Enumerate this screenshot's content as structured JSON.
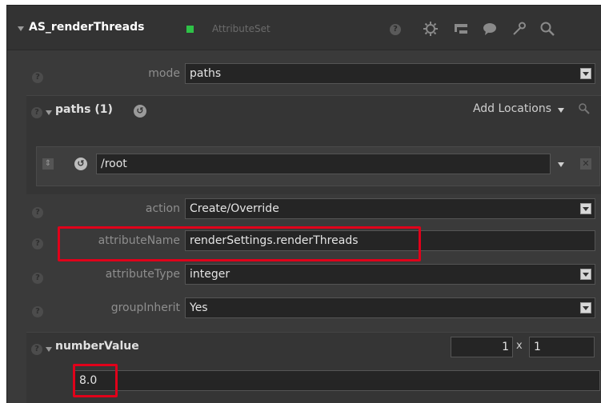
{
  "header": {
    "node_name": "AS_renderThreads",
    "node_type": "AttributeSet",
    "help": "?"
  },
  "params": {
    "mode": {
      "label": "mode",
      "value": "paths"
    },
    "paths_group": {
      "title": "paths (1)",
      "add_locations": "Add Locations",
      "path_value": "/root"
    },
    "action": {
      "label": "action",
      "value": "Create/Override"
    },
    "attributeName": {
      "label": "attributeName",
      "value": "renderSettings.renderThreads"
    },
    "attributeType": {
      "label": "attributeType",
      "value": "integer"
    },
    "groupInherit": {
      "label": "groupInherit",
      "value": "Yes"
    },
    "numberValue": {
      "title": "numberValue",
      "count": "1",
      "sep": "x",
      "tuple": "1",
      "value": "8.0"
    }
  },
  "help_glyph": "?",
  "colors": {
    "node_color": "#2ec247",
    "highlight": "#e0001a"
  }
}
